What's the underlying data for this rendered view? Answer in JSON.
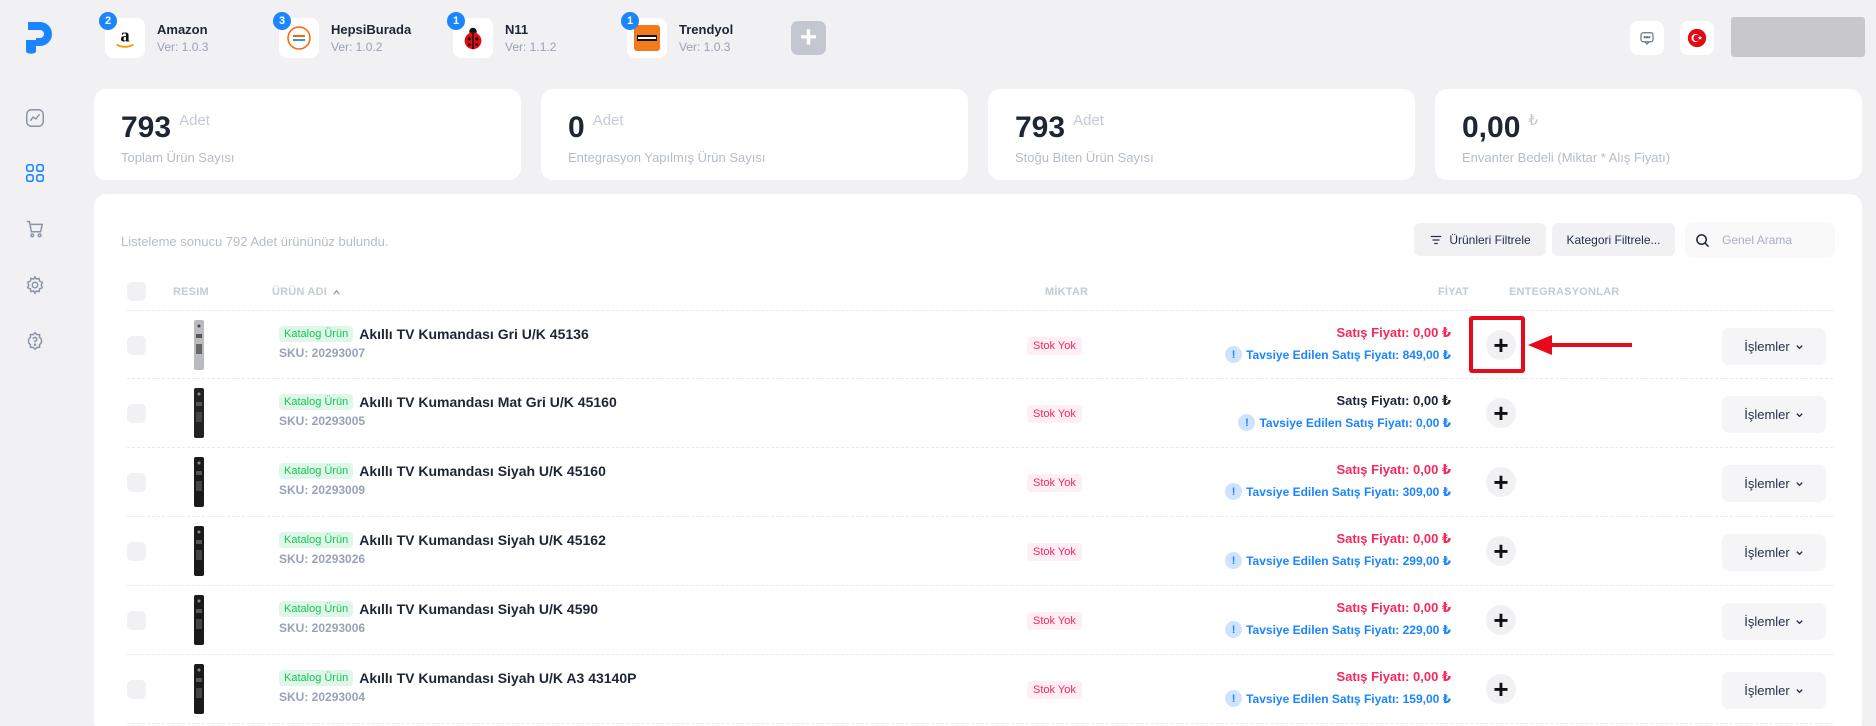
{
  "integrations": [
    {
      "name": "Amazon",
      "version": "Ver: 1.0.3",
      "badge": "2"
    },
    {
      "name": "HepsiBurada",
      "version": "Ver: 1.0.2",
      "badge": "3"
    },
    {
      "name": "N11",
      "version": "Ver: 1.1.2",
      "badge": "1"
    },
    {
      "name": "Trendyol",
      "version": "Ver: 1.0.3",
      "badge": "1"
    }
  ],
  "stats": [
    {
      "value": "793",
      "unit": "Adet",
      "label": "Toplam Ürün Sayısı"
    },
    {
      "value": "0",
      "unit": "Adet",
      "label": "Entegrasyon Yapılmış Ürün Sayısı"
    },
    {
      "value": "793",
      "unit": "Adet",
      "label": "Stoğu Biten Ürün Sayısı"
    },
    {
      "value": "0,00",
      "unit": "₺",
      "label": "Envanter Bedeli (Miktar * Alış Fiyatı)"
    }
  ],
  "list": {
    "result_text": "Listeleme sonucu 792 Adet ürününüz bulundu.",
    "filter_products": "Ürünleri Filtrele",
    "filter_category": "Kategori Filtrele...",
    "search_placeholder": "Genel Arama",
    "columns": {
      "image": "RESIM",
      "name": "ÜRÜN ADI",
      "quantity": "MİKTAR",
      "price": "FİYAT",
      "integrations": "ENTEGRASYONLAR"
    }
  },
  "rows": [
    {
      "tag": "Katalog Ürün",
      "name": "Akıllı TV Kumandası Gri U/K 45136",
      "sku": "SKU: 20293007",
      "stock": "Stok Yok",
      "sale": "Satış Fiyatı: 0,00 ₺",
      "recommended": "Tavsiye Edilen Satış Fiyatı: 849,00 ₺",
      "ops": "İşlemler"
    },
    {
      "tag": "Katalog Ürün",
      "name": "Akıllı TV Kumandası Mat Gri U/K 45160",
      "sku": "SKU: 20293005",
      "stock": "Stok Yok",
      "sale": "Satış Fiyatı: 0,00 ₺",
      "recommended": "Tavsiye Edilen Satış Fiyatı: 0,00 ₺",
      "ops": "İşlemler"
    },
    {
      "tag": "Katalog Ürün",
      "name": "Akıllı TV Kumandası Siyah U/K 45160",
      "sku": "SKU: 20293009",
      "stock": "Stok Yok",
      "sale": "Satış Fiyatı: 0,00 ₺",
      "recommended": "Tavsiye Edilen Satış Fiyatı: 309,00 ₺",
      "ops": "İşlemler"
    },
    {
      "tag": "Katalog Ürün",
      "name": "Akıllı TV Kumandası Siyah U/K 45162",
      "sku": "SKU: 20293026",
      "stock": "Stok Yok",
      "sale": "Satış Fiyatı: 0,00 ₺",
      "recommended": "Tavsiye Edilen Satış Fiyatı: 299,00 ₺",
      "ops": "İşlemler"
    },
    {
      "tag": "Katalog Ürün",
      "name": "Akıllı TV Kumandası Siyah U/K 4590",
      "sku": "SKU: 20293006",
      "stock": "Stok Yok",
      "sale": "Satış Fiyatı: 0,00 ₺",
      "recommended": "Tavsiye Edilen Satış Fiyatı: 229,00 ₺",
      "ops": "İşlemler"
    },
    {
      "tag": "Katalog Ürün",
      "name": "Akıllı TV Kumandası Siyah U/K A3 43140P",
      "sku": "SKU: 20293004",
      "stock": "Stok Yok",
      "sale": "Satış Fiyatı: 0,00 ₺",
      "recommended": "Tavsiye Edilen Satış Fiyatı: 159,00 ₺",
      "ops": "İşlemler"
    }
  ],
  "colors": {
    "accent": "#1b84ff",
    "danger": "#f8285a",
    "success": "#17c653",
    "annotation": "#e8091a"
  }
}
